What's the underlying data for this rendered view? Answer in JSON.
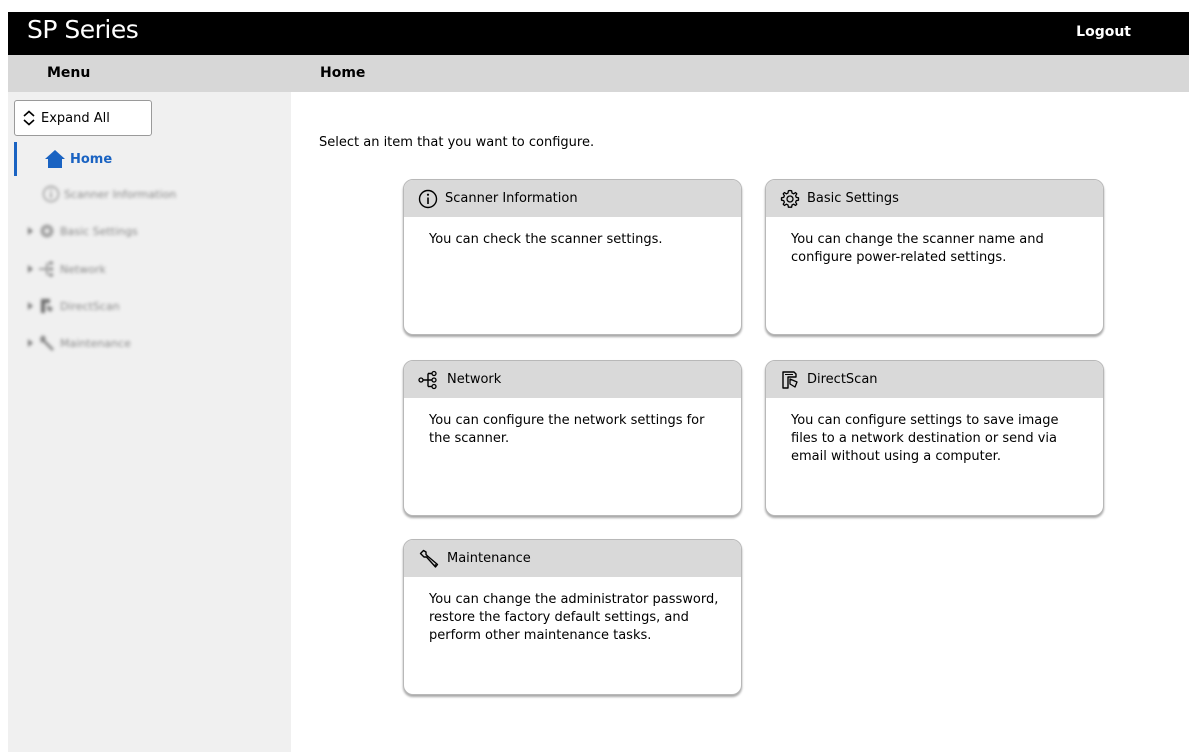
{
  "app": {
    "title": "SP Series",
    "logout_label": "Logout"
  },
  "header": {
    "menu_label": "Menu",
    "page_title": "Home"
  },
  "sidebar": {
    "expand_label": "Expand All",
    "items": [
      {
        "label": "Home",
        "icon": "home-icon",
        "active": true
      },
      {
        "label": "Scanner Information",
        "icon": "info-icon"
      },
      {
        "label": "Basic Settings",
        "icon": "gear-icon"
      },
      {
        "label": "Network",
        "icon": "network-icon"
      },
      {
        "label": "DirectScan",
        "icon": "directscan-icon"
      },
      {
        "label": "Maintenance",
        "icon": "wrench-icon"
      }
    ]
  },
  "main": {
    "intro": "Select an item that you want to configure.",
    "cards": [
      {
        "title": "Scanner Information",
        "icon": "info-icon",
        "description": "You can check the scanner settings."
      },
      {
        "title": "Basic Settings",
        "icon": "gear-icon",
        "description": "You can change the scanner name and configure power-related settings."
      },
      {
        "title": "Network",
        "icon": "network-icon",
        "description": "You can configure the network settings for the scanner."
      },
      {
        "title": "DirectScan",
        "icon": "directscan-icon",
        "description": "You can configure settings to save image files to a network destination or send via email without using a computer."
      },
      {
        "title": "Maintenance",
        "icon": "wrench-icon",
        "description": "You can change the administrator password, restore the factory default settings, and perform other maintenance tasks."
      }
    ]
  },
  "colors": {
    "accent": "#1a63c2",
    "topbar": "#000000",
    "headerbar": "#d7d7d7",
    "sidebar": "#f0f0f0",
    "card_header": "#d9d9d9"
  }
}
